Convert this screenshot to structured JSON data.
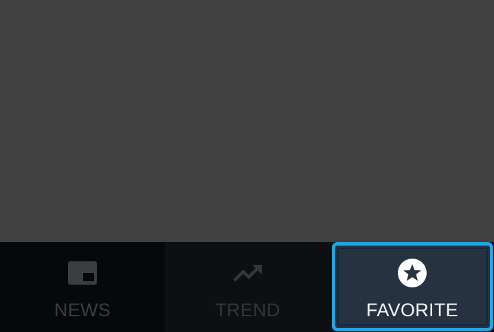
{
  "nav": {
    "items": [
      {
        "label": "NEWS",
        "icon": "picture-in-picture-icon",
        "selected": false
      },
      {
        "label": "TREND",
        "icon": "trending-up-icon",
        "selected": false
      },
      {
        "label": "FAVORITE",
        "icon": "star-circle-icon",
        "selected": true
      }
    ]
  },
  "colors": {
    "content_background": "#404040",
    "nav_background": "#0b0c0e",
    "inactive_text": "#3b3d40",
    "focus_ring": "#1aa8ea",
    "selected_background": "#273241",
    "selected_text": "#ffffff"
  }
}
